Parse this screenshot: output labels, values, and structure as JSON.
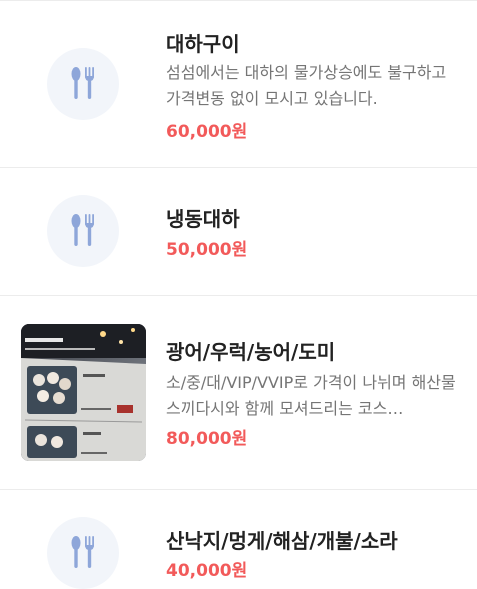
{
  "colors": {
    "price": "#f25a5a",
    "placeholder_bg": "#f2f5fa",
    "placeholder_icon": "#8ea6d9"
  },
  "menu_items": [
    {
      "name": "대하구이",
      "description": "섬섬에서는 대하의 물가상승에도 불구하고 가격변동 없이 모시고 있습니다.",
      "price": "60,000원",
      "icon": "fork-knife-icon"
    },
    {
      "name": "냉동대하",
      "description": "",
      "price": "50,000원",
      "icon": "fork-knife-icon"
    },
    {
      "name": "광어/우럭/농어/도미",
      "description": "소/중/대/VIP/VVIP로 가격이 나뉘며 해산물 스끼다시와 함께 모셔드리는 코스 요리입니다.",
      "price": "80,000원",
      "icon": "menu-photo"
    },
    {
      "name": "산낙지/멍게/해삼/개불/소라",
      "description": "",
      "price": "40,000원",
      "icon": "fork-knife-icon"
    }
  ]
}
